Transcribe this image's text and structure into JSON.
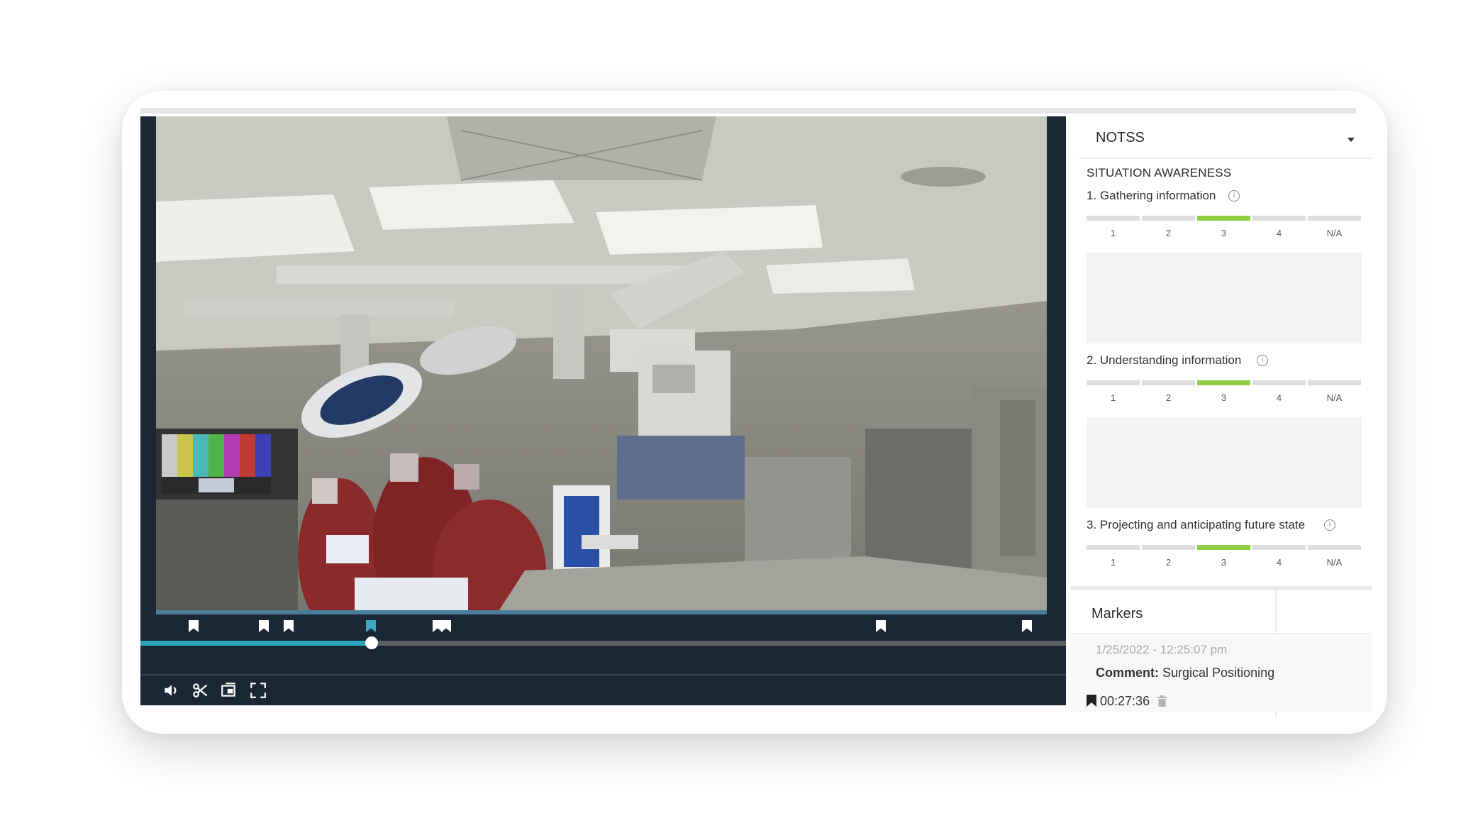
{
  "panel": {
    "title": "NOTSS",
    "section": "SITUATION AWARENESS",
    "scale_labels": [
      "1",
      "2",
      "3",
      "4",
      "N/A"
    ],
    "questions": [
      {
        "label": "1. Gathering information",
        "selected": "3"
      },
      {
        "label": "2. Understanding information",
        "selected": "3"
      },
      {
        "label": "3. Projecting and anticipating future state",
        "selected": "3"
      }
    ]
  },
  "markers": {
    "title": "Markers",
    "entry": {
      "datetime": "1/25/2022 - 12:25:07 pm",
      "comment_label": "Comment:",
      "comment_text": "Surgical Positioning",
      "timestamp": "00:27:36"
    }
  },
  "video": {
    "progress_fraction": 0.25,
    "controls": [
      "volume-icon",
      "scissors-icon",
      "snapshot-icon",
      "fullscreen-icon"
    ]
  },
  "colors": {
    "player_bg": "#1b2734",
    "progress_accent": "#2aa3bb",
    "rating_selected": "#8fcf46"
  }
}
